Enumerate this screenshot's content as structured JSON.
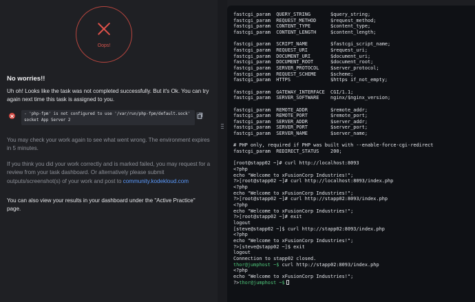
{
  "left_panel": {
    "oops_label": "Oops!",
    "heading": "No worries!!",
    "message": "Uh oh! Looks like the task was not completed successfully. But it's Ok. You can try again next time this task is assigned to you.",
    "error_text": "- 'php-fpm' is not configured to use '/var/run/php-fpm/default.sock'\nsocket App Server 2",
    "check_note": "You may check your work again to see what went wrong. The environment expires in 5 minutes.",
    "review_note_before_link": "If you think you did your work correctly and is marked failed, you may request for a review from your task dashboard. Or alternatively please submit outputs/screenshot(s) of your work and post to ",
    "review_link": "community.kodekloud.com",
    "dashboard_note": "You can also view your results in your dashboard under the \"Active Practice\" page."
  },
  "terminal": {
    "lines": [
      {
        "text": "fastcgi_param  QUERY_STRING       $query_string;",
        "style": "plain"
      },
      {
        "text": "fastcgi_param  REQUEST_METHOD     $request_method;",
        "style": "plain"
      },
      {
        "text": "fastcgi_param  CONTENT_TYPE       $content_type;",
        "style": "plain"
      },
      {
        "text": "fastcgi_param  CONTENT_LENGTH     $content_length;",
        "style": "plain"
      },
      {
        "text": "",
        "style": "plain"
      },
      {
        "text": "fastcgi_param  SCRIPT_NAME        $fastcgi_script_name;",
        "style": "plain"
      },
      {
        "text": "fastcgi_param  REQUEST_URI        $request_uri;",
        "style": "plain"
      },
      {
        "text": "fastcgi_param  DOCUMENT_URI       $document_uri;",
        "style": "plain"
      },
      {
        "text": "fastcgi_param  DOCUMENT_ROOT      $document_root;",
        "style": "plain"
      },
      {
        "text": "fastcgi_param  SERVER_PROTOCOL    $server_protocol;",
        "style": "plain"
      },
      {
        "text": "fastcgi_param  REQUEST_SCHEME     $scheme;",
        "style": "plain"
      },
      {
        "text": "fastcgi_param  HTTPS              $https if_not_empty;",
        "style": "plain"
      },
      {
        "text": "",
        "style": "plain"
      },
      {
        "text": "fastcgi_param  GATEWAY_INTERFACE  CGI/1.1;",
        "style": "plain"
      },
      {
        "text": "fastcgi_param  SERVER_SOFTWARE    nginx/$nginx_version;",
        "style": "plain"
      },
      {
        "text": "",
        "style": "plain"
      },
      {
        "text": "fastcgi_param  REMOTE_ADDR        $remote_addr;",
        "style": "plain"
      },
      {
        "text": "fastcgi_param  REMOTE_PORT        $remote_port;",
        "style": "plain"
      },
      {
        "text": "fastcgi_param  SERVER_ADDR        $server_addr;",
        "style": "plain"
      },
      {
        "text": "fastcgi_param  SERVER_PORT        $server_port;",
        "style": "plain"
      },
      {
        "text": "fastcgi_param  SERVER_NAME        $server_name;",
        "style": "plain"
      },
      {
        "text": "",
        "style": "plain"
      },
      {
        "text": "# PHP only, required if PHP was built with --enable-force-cgi-redirect",
        "style": "plain"
      },
      {
        "text": "fastcgi_param  REDIRECT_STATUS    200;",
        "style": "plain"
      },
      {
        "text": "",
        "style": "plain"
      },
      {
        "text": "[root@stapp02 ~]# curl http://localhost:8093",
        "style": "plain"
      },
      {
        "text": "<?php",
        "style": "plain"
      },
      {
        "text": "echo \"Welcome to xFusionCorp Industries!\";",
        "style": "plain"
      },
      {
        "text": "?>[root@stapp02 ~]# curl http://localhost:8093/index.php",
        "style": "plain"
      },
      {
        "text": "<?php",
        "style": "plain"
      },
      {
        "text": "echo \"Welcome to xFusionCorp Industries!\";",
        "style": "plain"
      },
      {
        "text": "?>[root@stapp02 ~]# curl http://stapp02:8093/index.php",
        "style": "plain"
      },
      {
        "text": "<?php",
        "style": "plain"
      },
      {
        "text": "echo \"Welcome to xFusionCorp Industries!\";",
        "style": "plain"
      },
      {
        "text": "?>[root@stapp02 ~]# exit",
        "style": "plain"
      },
      {
        "text": "logout",
        "style": "plain"
      },
      {
        "text": "[steve@stapp02 ~]$ curl http://stapp02:8093/index.php",
        "style": "plain"
      },
      {
        "text": "<?php",
        "style": "plain"
      },
      {
        "text": "echo \"Welcome to xFusionCorp Industries!\";",
        "style": "plain"
      },
      {
        "text": "?>[steve@stapp02 ~]$ exit",
        "style": "plain"
      },
      {
        "text": "logout",
        "style": "plain"
      },
      {
        "text": "Connection to stapp02 closed.",
        "style": "plain"
      },
      {
        "text": "thor@jumphost ~$ curl http://stapp02:8093/index.php",
        "style": "prompt",
        "prompt": "thor@jumphost ~$",
        "rest": " curl http://stapp02:8093/index.php"
      },
      {
        "text": "<?php",
        "style": "plain"
      },
      {
        "text": "echo \"Welcome to xFusionCorp Industries!\";",
        "style": "plain"
      },
      {
        "text": "?>thor@jumphost ~$",
        "style": "cursor",
        "before": "?>",
        "prompt": "thor@jumphost ~$"
      }
    ]
  },
  "colors": {
    "panel_bg": "#1f2024",
    "terminal_bg": "#0f1115",
    "error_red": "#d9564d",
    "link_blue": "#5b9bff",
    "prompt_green": "#4fc67a"
  }
}
